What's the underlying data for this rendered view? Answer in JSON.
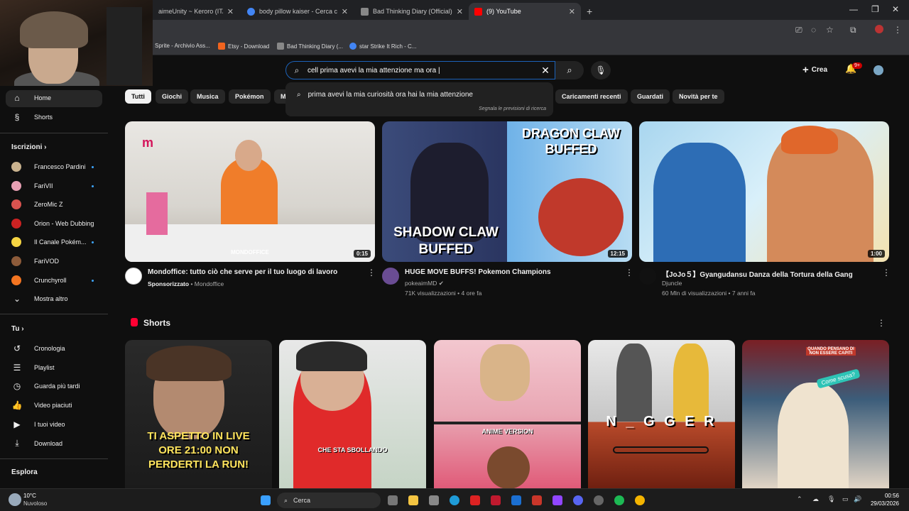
{
  "browser": {
    "tabs": [
      {
        "label": "aimeUnity ~ Keroro (ITA) Stre",
        "active": false,
        "favicon_color": "#555"
      },
      {
        "label": "body pillow kaiser - Cerca con G",
        "active": false,
        "favicon_color": "#4285f4"
      },
      {
        "label": "Bad Thinking Diary (Official) - L",
        "active": false,
        "favicon_color": "#888"
      },
      {
        "label": "(9) YouTube",
        "active": true,
        "favicon_color": "#ff0000"
      }
    ],
    "new_tab": "+",
    "bookmarks": [
      {
        "label": "Sprite - Archivio Ass...",
        "icon_color": "#6aa84f"
      },
      {
        "label": "Etsy - Download",
        "icon_color": "#f1641e"
      },
      {
        "label": "Bad Thinking Diary (...",
        "icon_color": "#888"
      },
      {
        "label": "star Strike It Rich - C...",
        "icon_color": "#4285f4"
      }
    ]
  },
  "header": {
    "search_value": "cell prima avevi la mia attenzione ma ora |",
    "create_label": "Crea",
    "notif_badge": "9+"
  },
  "dropdown": {
    "suggestion": "prima avevi la mia curiosità ora hai la mia attenzione",
    "report": "Segnala le previsioni di ricerca"
  },
  "chips": [
    "Tutti",
    "Giochi",
    "Musica",
    "Pokémon",
    "M",
    "Caricamenti recenti",
    "Guardati",
    "Novità per te"
  ],
  "sidebar": {
    "home": "Home",
    "shorts": "Shorts",
    "subs_header": "Iscrizioni",
    "subs": [
      {
        "name": "Francesco Pardini",
        "color": "#c9b28e",
        "dot": true
      },
      {
        "name": "FariVII",
        "color": "#e8a0b4",
        "dot": true
      },
      {
        "name": "ZeroMic Z",
        "color": "#d9534f",
        "dot": false
      },
      {
        "name": "Orion - Web Dubbing",
        "color": "#cc2222",
        "dot": false
      },
      {
        "name": "Il Canale Pokém...",
        "color": "#f5d442",
        "dot": true
      },
      {
        "name": "FariVOD",
        "color": "#8d5b3a",
        "dot": false
      },
      {
        "name": "Crunchyroll",
        "color": "#f47521",
        "dot": true
      }
    ],
    "show_more": "Mostra altro",
    "you_header": "Tu",
    "you_items": [
      "Cronologia",
      "Playlist",
      "Guarda più tardi",
      "Video piaciuti",
      "I tuoi video",
      "Download"
    ],
    "explore_header": "Esplora"
  },
  "videos": [
    {
      "title": "Mondoffice: tutto ciò che serve per il tuo luogo di lavoro",
      "channel": "Mondoffice",
      "sponsored": "Sponsorizzato",
      "meta": "",
      "duration": "0:15",
      "brand": "MONDOFFICE"
    },
    {
      "title": "HUGE MOVE BUFFS! Pokemon Champions",
      "channel": "pokeaimMD",
      "meta": "71K visualizzazioni • 4 ore fa",
      "duration": "12:15",
      "overlay_top": "DRAGON CLAW BUFFED",
      "overlay_bottom": "SHADOW CLAW BUFFED"
    },
    {
      "title": "【JoJo５】Gyangudansu  Danza della Tortura della Gang",
      "channel": "Djuncle",
      "meta": "60 Mln di visualizzazioni • 7 anni fa",
      "duration": "1:00"
    }
  ],
  "shorts_section": {
    "title": "Shorts",
    "items": [
      {
        "text": "TI ASPETTO IN LIVE ORE 21:00 NON PERDERTI LA RUN!"
      },
      {
        "text": "CHE STA SBOLLANDO"
      },
      {
        "text": "ANIME VERSION"
      },
      {
        "text": "N _ G G E R"
      },
      {
        "text": "Come scusa?",
        "top_text": "QUANDO PENSANO DI NON ESSERE CAPITI"
      }
    ]
  },
  "taskbar": {
    "weather_temp": "10°C",
    "weather_desc": "Nuvoloso",
    "search_label": "Cerca",
    "time": "00:56",
    "date": "29/03/2026"
  }
}
